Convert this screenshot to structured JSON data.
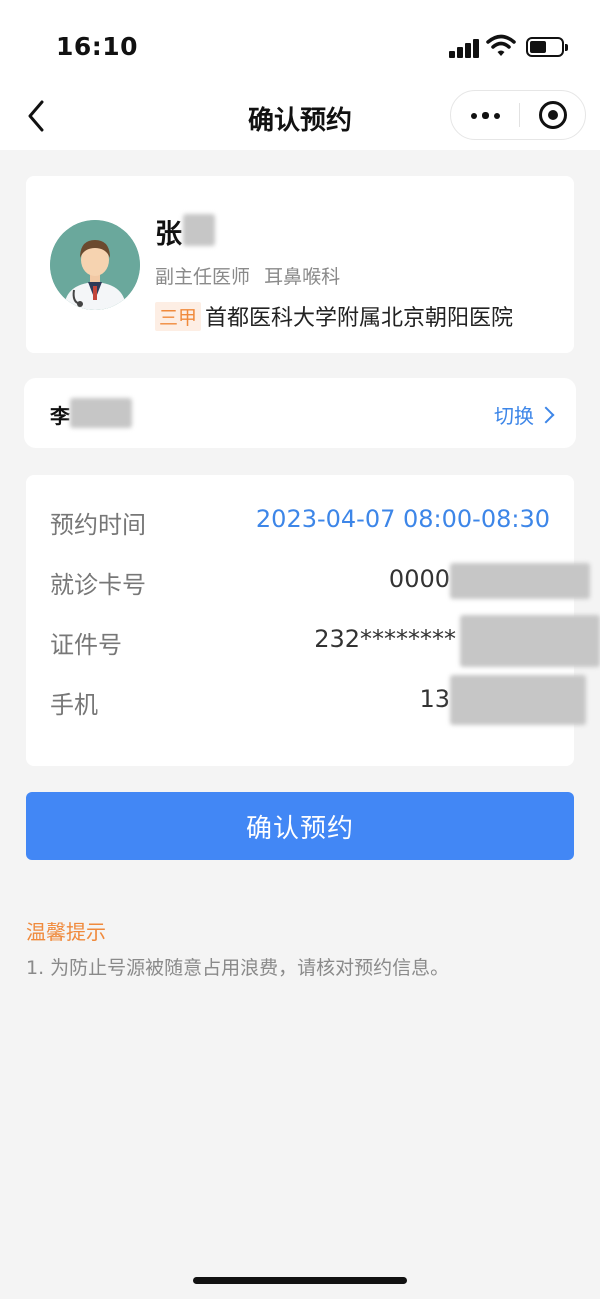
{
  "status_bar": {
    "time": "16:10",
    "icons": [
      "cellular-signal-icon",
      "wifi-icon",
      "battery-icon"
    ]
  },
  "nav": {
    "title": "确认预约",
    "icons": [
      "back-chevron-icon",
      "more-dots-icon",
      "close-target-icon"
    ]
  },
  "doctor": {
    "name": "张",
    "title": "副主任医师",
    "department": "耳鼻喉科",
    "hospital_level": "三甲",
    "hospital": "首都医科大学附属北京朝阳医院",
    "avatar_icon": "doctor-avatar-icon"
  },
  "patient": {
    "name": "李",
    "switch_label": "切换"
  },
  "appointment": {
    "rows": [
      {
        "label": "预约时间",
        "value": "2023-04-07 08:00-08:30"
      },
      {
        "label": "就诊卡号",
        "value": "0000"
      },
      {
        "label": "证件号",
        "value": "232********"
      },
      {
        "label": "手机",
        "value": "13"
      }
    ]
  },
  "confirm_button": "确认预约",
  "tips": {
    "title": "温馨提示",
    "text": "1. 为防止号源被随意占用浪费，请核对预约信息。"
  },
  "colors": {
    "accent": "#4287f5",
    "link": "#3d86e8",
    "warning": "#f08a3c",
    "background": "#f4f4f4"
  }
}
